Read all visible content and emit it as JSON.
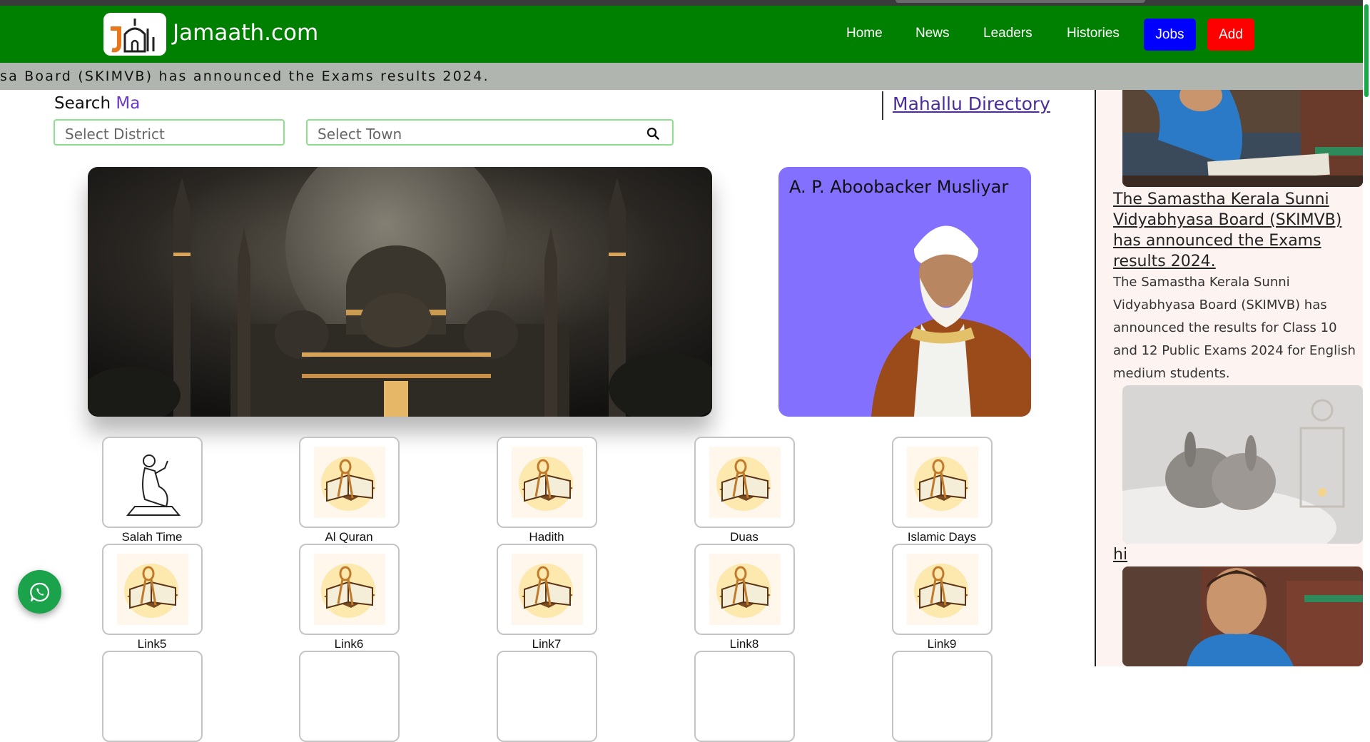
{
  "brand": {
    "name": "Jamaath.com"
  },
  "nav": {
    "links": [
      "Home",
      "News",
      "Leaders",
      "Histories"
    ],
    "jobs_label": "Jobs",
    "add_label": "Add",
    "jobs_color": "#0000ff",
    "add_color": "#ff0000",
    "bar_color": "#008000"
  },
  "ticker": {
    "text": "sa Board (SKIMVB) has announced the Exams results 2024."
  },
  "search": {
    "label": "Search",
    "label_accent": "Ma",
    "district_placeholder": "Select District",
    "town_placeholder": "Select Town"
  },
  "directory_link": "Mahallu Directory",
  "leader": {
    "name": "A. P. Aboobacker Musliyar",
    "card_color": "#8470ff"
  },
  "tiles": {
    "row1": [
      "Salah Time",
      "Al Quran",
      "Hadith",
      "Duas",
      "Islamic Days"
    ],
    "row2": [
      "Link5",
      "Link6",
      "Link7",
      "Link8",
      "Link9"
    ]
  },
  "sidebar": {
    "news": [
      {
        "title": "The Samastha Kerala Sunni Vidyabhyasa Board (SKIMVB) has announced the Exams results 2024.",
        "description": "The Samastha Kerala Sunni Vidyabhyasa Board (SKIMVB) has announced the results for Class 10 and 12 Public Exams 2024 for English medium students."
      },
      {
        "title": "hi"
      }
    ]
  },
  "icons": {
    "search": "search-icon",
    "whatsapp": "whatsapp-icon",
    "quran": "quran-icon",
    "prayer": "prayer-icon"
  }
}
